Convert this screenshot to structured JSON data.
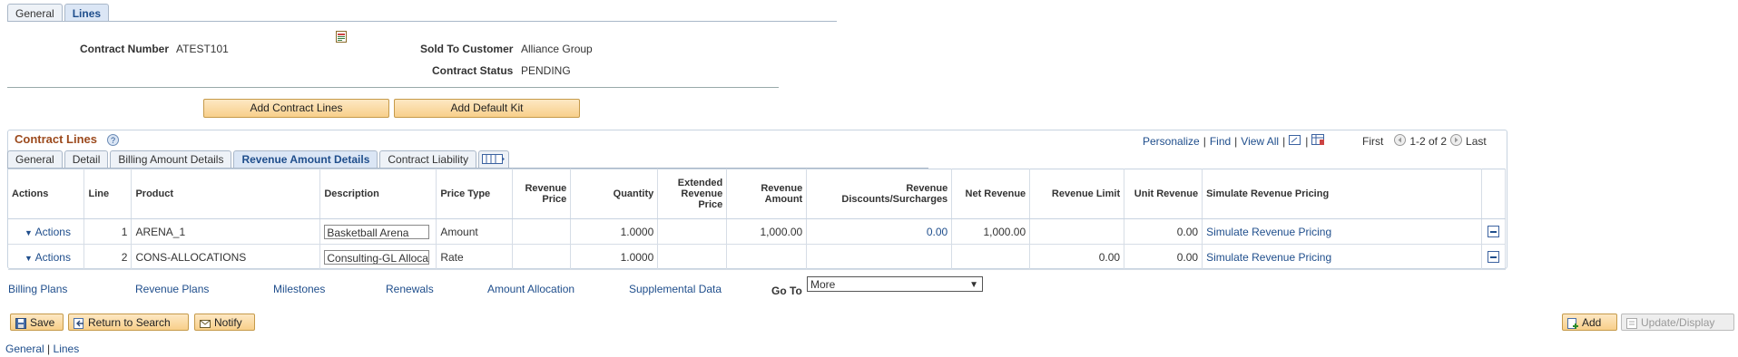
{
  "top_tabs": [
    "General",
    "Lines"
  ],
  "header": {
    "contract_number_label": "Contract Number",
    "contract_number": "ATEST101",
    "sold_to_label": "Sold To Customer",
    "sold_to": "Alliance Group",
    "status_label": "Contract Status",
    "status": "PENDING"
  },
  "buttons": {
    "add_lines": "Add Contract Lines",
    "add_kit": "Add Default Kit"
  },
  "grid": {
    "title": "Contract Lines",
    "nav": {
      "personalize": "Personalize",
      "find": "Find",
      "view_all": "View All",
      "first": "First",
      "range": "1-2 of 2",
      "last": "Last"
    },
    "tabs": [
      "General",
      "Detail",
      "Billing Amount Details",
      "Revenue Amount Details",
      "Contract Liability"
    ],
    "columns": [
      "Actions",
      "Line",
      "Product",
      "Description",
      "Price Type",
      "Revenue Price",
      "Quantity",
      "Extended Revenue Price",
      "Revenue Amount",
      "Revenue Discounts/Surcharges",
      "Net Revenue",
      "Revenue Limit",
      "Unit Revenue",
      "Simulate Revenue Pricing"
    ],
    "rows": [
      {
        "actions": "Actions",
        "line": "1",
        "product": "ARENA_1",
        "description": "Basketball Arena",
        "price_type": "Amount",
        "revenue_price": "",
        "quantity": "1.0000",
        "extended": "",
        "revenue_amount": "1,000.00",
        "discounts": "0.00",
        "net_revenue": "1,000.00",
        "revenue_limit": "",
        "unit_revenue": "0.00",
        "simulate": "Simulate Revenue Pricing"
      },
      {
        "actions": "Actions",
        "line": "2",
        "product": "CONS-ALLOCATIONS",
        "description": "Consulting-GL Allocat",
        "price_type": "Rate",
        "revenue_price": "",
        "quantity": "1.0000",
        "extended": "",
        "revenue_amount": "",
        "discounts": "",
        "net_revenue": "",
        "revenue_limit": "0.00",
        "unit_revenue": "0.00",
        "simulate": "Simulate Revenue Pricing"
      }
    ]
  },
  "links": [
    "Billing Plans",
    "Revenue Plans",
    "Milestones",
    "Renewals",
    "Amount Allocation",
    "Supplemental Data"
  ],
  "goto": {
    "label": "Go To",
    "selected": "More"
  },
  "footer": {
    "save": "Save",
    "return": "Return to Search",
    "notify": "Notify",
    "add": "Add",
    "update": "Update/Display",
    "link_general": "General",
    "link_sep": "|",
    "link_lines": "Lines"
  }
}
